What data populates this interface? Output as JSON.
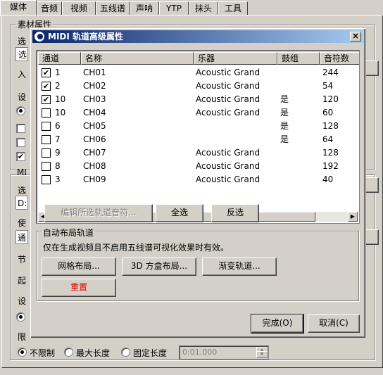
{
  "tabs": [
    "媒体",
    "音频",
    "视频",
    "五线谱",
    "声呐",
    "YTP",
    "抹头",
    "工具"
  ],
  "bg": {
    "group1_title": "素材属性",
    "labels": [
      "选",
      "选",
      "入",
      "设",
      "MI",
      "选",
      "D:",
      "使",
      "通",
      "节",
      "起",
      "设"
    ],
    "limit_label": "限",
    "radio_nolimit": "不限制",
    "radio_maxlen": "最大长度",
    "radio_fixed": "固定长度",
    "fixed_value": "0:01.000"
  },
  "dialog": {
    "title": "MIDI 轨道高级属性",
    "columns": [
      "通道",
      "名称",
      "乐器",
      "鼓组",
      "音符数"
    ],
    "rows": [
      {
        "checked": true,
        "channel": "1",
        "name": "CH01",
        "instrument": "Acoustic Grand",
        "drum": "",
        "notes": "244"
      },
      {
        "checked": true,
        "channel": "2",
        "name": "CH02",
        "instrument": "Acoustic Grand",
        "drum": "",
        "notes": "54"
      },
      {
        "checked": true,
        "channel": "10",
        "name": "CH03",
        "instrument": "Acoustic Grand",
        "drum": "是",
        "notes": "120"
      },
      {
        "checked": false,
        "channel": "10",
        "name": "CH04",
        "instrument": "Acoustic Grand",
        "drum": "是",
        "notes": "60"
      },
      {
        "checked": false,
        "channel": "6",
        "name": "CH05",
        "instrument": "",
        "drum": "是",
        "notes": "128"
      },
      {
        "checked": false,
        "channel": "7",
        "name": "CH06",
        "instrument": "",
        "drum": "是",
        "notes": "64"
      },
      {
        "checked": false,
        "channel": "9",
        "name": "CH07",
        "instrument": "Acoustic Grand",
        "drum": "",
        "notes": "128"
      },
      {
        "checked": false,
        "channel": "8",
        "name": "CH08",
        "instrument": "Acoustic Grand",
        "drum": "",
        "notes": "192"
      },
      {
        "checked": false,
        "channel": "3",
        "name": "CH09",
        "instrument": "Acoustic Grand",
        "drum": "",
        "notes": "40"
      }
    ],
    "edit_notes_label": "编辑所选轨道音符...",
    "select_all_label": "全选",
    "invert_label": "反选",
    "auto_layout": {
      "title": "自动布局轨道",
      "desc": "仅在生成视频且不启用五线谱可视化效果时有效。",
      "grid_label": "网格布局...",
      "box3d_label": "3D 方盒布局...",
      "gradient_label": "渐变轨道...",
      "reset_label": "重置"
    },
    "ok_label": "完成(O)",
    "cancel_label": "取消(C)"
  },
  "colors": {
    "titlebar_start": "#0a246a",
    "titlebar_end": "#a6caf0",
    "reset_text": "#e00000"
  }
}
